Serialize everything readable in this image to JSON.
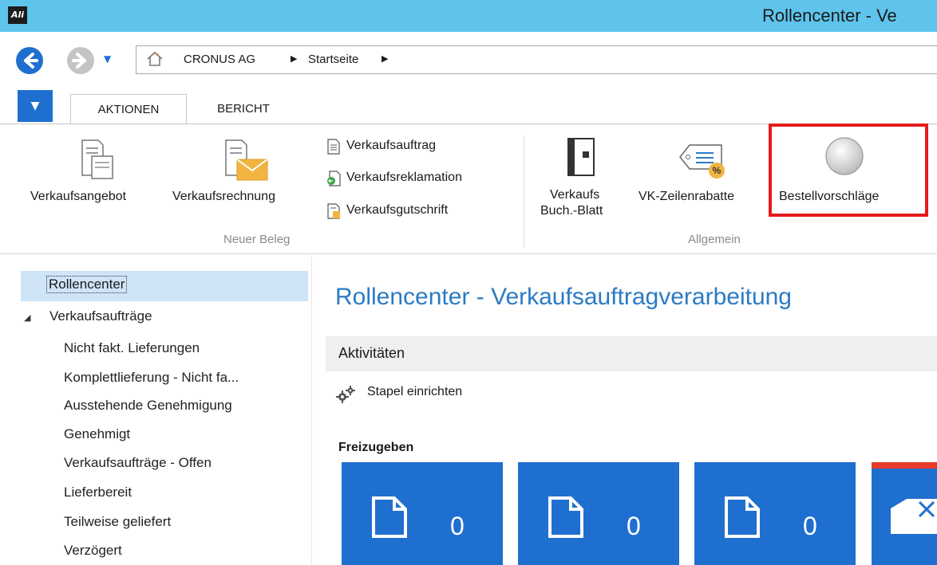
{
  "window": {
    "title": "Rollencenter - Ve",
    "logo_text": "Ali"
  },
  "navigation": {
    "breadcrumb": [
      "CRONUS AG",
      "Startseite"
    ],
    "separator": "▶"
  },
  "ribbon": {
    "menu_icon": "▼",
    "tabs": [
      {
        "label": "AKTIONEN",
        "active": true
      },
      {
        "label": "BERICHT",
        "active": false
      }
    ],
    "groups": {
      "neuer_beleg": {
        "label": "Neuer Beleg",
        "big_buttons": [
          "Verkaufsangebot",
          "Verkaufsrechnung"
        ],
        "small_buttons": [
          "Verkaufsauftrag",
          "Verkaufsreklamation",
          "Verkaufsgutschrift"
        ]
      },
      "allgemein": {
        "label": "Allgemein",
        "buttons": {
          "verkaufs_line1": "Verkaufs",
          "verkaufs_line2": "Buch.-Blatt",
          "vk_zeilenrabatte": "VK-Zeilenrabatte",
          "bestellvorschlaege": "Bestellvorschläge"
        }
      }
    }
  },
  "sidebar": {
    "selected": "Rollencenter",
    "group": "Verkaufsaufträge",
    "group_icon": "◢",
    "items": [
      "Nicht fakt. Lieferungen",
      "Komplettlieferung - Nicht fa...",
      "Ausstehende Genehmigung",
      "Genehmigt",
      "Verkaufsaufträge - Offen",
      "Lieferbereit",
      "Teilweise geliefert",
      "Verzögert"
    ]
  },
  "main": {
    "title": "Rollencenter - Verkaufsauftragverarbeitung",
    "section": "Aktivitäten",
    "action": "Stapel einrichten",
    "subheading": "Freizugeben",
    "tiles": [
      {
        "count": "0"
      },
      {
        "count": "0"
      },
      {
        "count": "0"
      }
    ]
  },
  "colors": {
    "titlebar": "#5ec4ec",
    "accent": "#1f6fd0",
    "highlight": "#e41c1c",
    "title_text": "#2b7bc3"
  }
}
